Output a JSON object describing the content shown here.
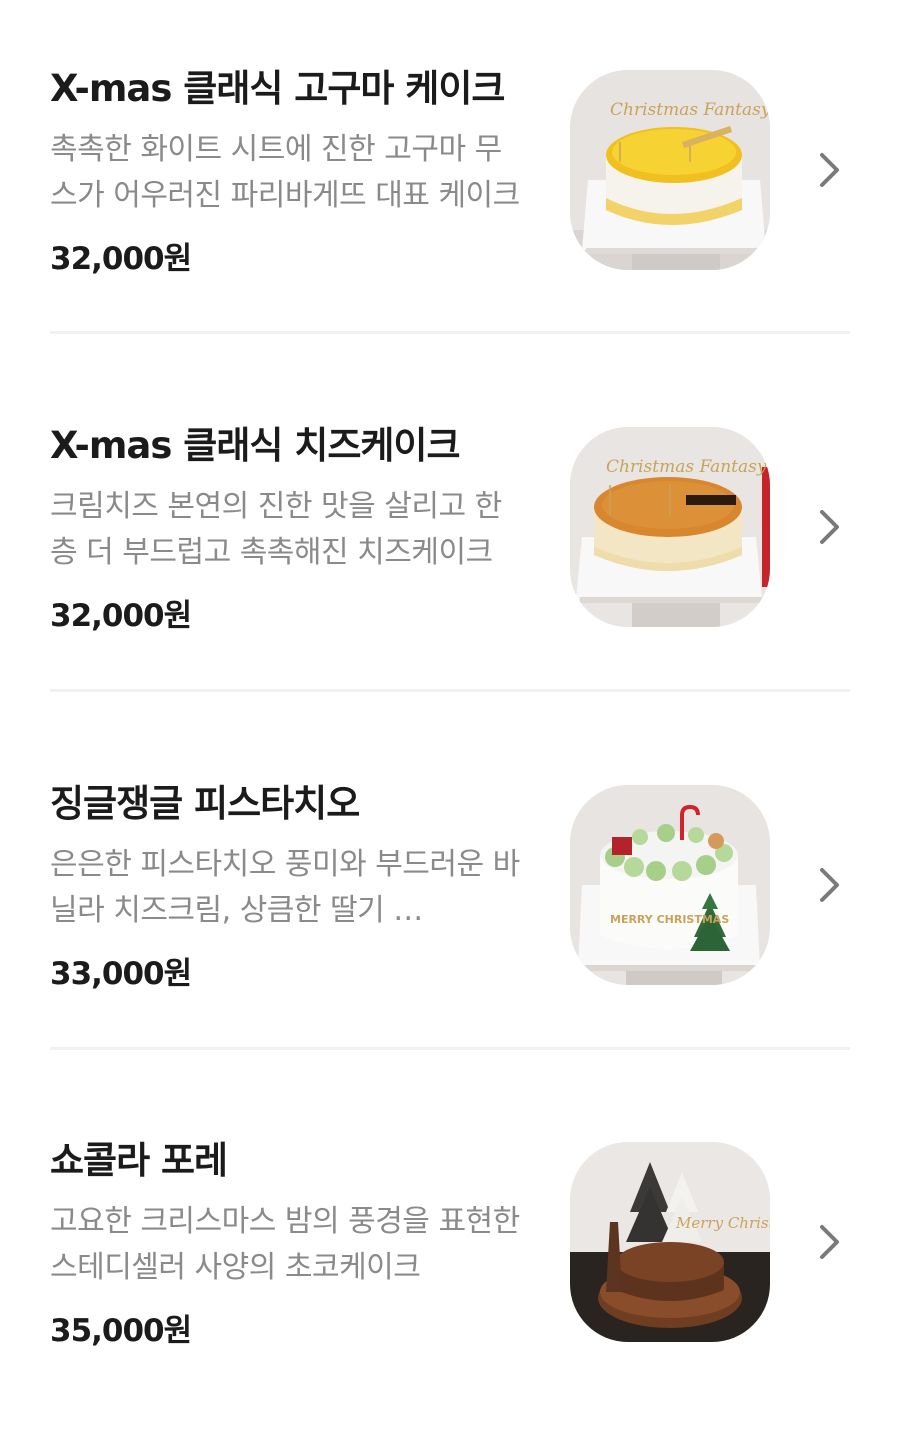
{
  "menu_items": [
    {
      "name": "X-mas 클래식 고구마 케이크",
      "description": "촉촉한 화이트 시트에 진한 고구마 무스가 어우러진 파리바게뜨 대표 케이크",
      "price": "32,000원",
      "image_text": "Christmas Fantasy"
    },
    {
      "name": "X-mas 클래식 치즈케이크",
      "description": "크림치즈 본연의 진한 맛을 살리고 한층 더 부드럽고 촉촉해진 치즈케이크",
      "price": "32,000원",
      "image_text": "Christmas Fantasy"
    },
    {
      "name": "징글쟁글 피스타치오",
      "description": "은은한 피스타치오 풍미와 부드러운 바닐라 치즈크림, 상큼한 딸기 …",
      "price": "33,000원",
      "image_text": "MERRY CHRISTMAS"
    },
    {
      "name": "쇼콜라 포레",
      "description": "고요한 크리스마스 밤의 풍경을 표현한 스테디셀러 사양의 초코케이크",
      "price": "35,000원",
      "image_text": "Merry Christmas"
    }
  ]
}
